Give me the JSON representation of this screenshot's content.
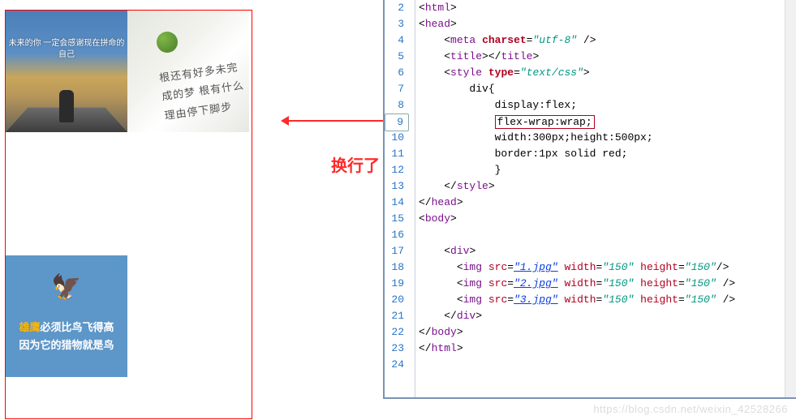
{
  "annotation": {
    "label": "换行了"
  },
  "preview": {
    "img1_text": "未来的你\n一定会感谢现在拼命的自己",
    "img2_text": "根还有好多未完成的梦\n根有什么理由停下脚步",
    "img3_text_before": "",
    "img3_text_orange": "雄鹰",
    "img3_line1_rest": "必须比鸟飞得高",
    "img3_line2": "因为它的猎物就是鸟"
  },
  "code": {
    "lines": [
      {
        "n": 2,
        "html": "<span class='t-tag'>&lt;</span><span class='t-name'>html</span><span class='t-tag'>&gt;</span>"
      },
      {
        "n": 3,
        "html": "<span class='t-tag'>&lt;</span><span class='t-name'>head</span><span class='t-tag'>&gt;</span>"
      },
      {
        "n": 4,
        "html": "    <span class='t-tag'>&lt;</span><span class='t-name'>meta</span> <span class='t-attr'>charset</span>=<span class='t-val'>\"utf-8\"</span> <span class='t-tag'>/&gt;</span>"
      },
      {
        "n": 5,
        "html": "    <span class='t-tag'>&lt;</span><span class='t-name'>title</span><span class='t-tag'>&gt;&lt;/</span><span class='t-name'>title</span><span class='t-tag'>&gt;</span>"
      },
      {
        "n": 6,
        "html": "    <span class='t-tag'>&lt;</span><span class='t-name'>style</span> <span class='t-attr'>type</span>=<span class='t-val'>\"text/css\"</span><span class='t-tag'>&gt;</span>"
      },
      {
        "n": 7,
        "html": "        div{"
      },
      {
        "n": 8,
        "html": "            display:flex;"
      },
      {
        "n": 9,
        "html": "            <span class='hl'>flex-wrap:wrap;</span>"
      },
      {
        "n": 10,
        "html": "            width:300px;height:500px;"
      },
      {
        "n": 11,
        "html": "            border:1px solid red;"
      },
      {
        "n": 12,
        "html": "            }"
      },
      {
        "n": 13,
        "html": "    <span class='t-tag'>&lt;/</span><span class='t-name'>style</span><span class='t-tag'>&gt;</span>"
      },
      {
        "n": 14,
        "html": "<span class='t-tag'>&lt;/</span><span class='t-name'>head</span><span class='t-tag'>&gt;</span>"
      },
      {
        "n": 15,
        "html": "<span class='t-tag'>&lt;</span><span class='t-name'>body</span><span class='t-tag'>&gt;</span>"
      },
      {
        "n": 16,
        "html": ""
      },
      {
        "n": 17,
        "html": "    <span class='t-tag'>&lt;</span><span class='t-name'>div</span><span class='t-tag'>&gt;</span>"
      },
      {
        "n": 18,
        "html": "      <span class='t-tag'>&lt;</span><span class='t-name'>img</span> <span class='t-attr2'>src</span>=<span class='t-str'>\"1.jpg\"</span> <span class='t-attr2'>width</span>=<span class='t-val'>\"150\"</span> <span class='t-attr2'>height</span>=<span class='t-val'>\"150\"</span><span class='t-tag'>/&gt;</span>"
      },
      {
        "n": 19,
        "html": "      <span class='t-tag'>&lt;</span><span class='t-name'>img</span> <span class='t-attr2'>src</span>=<span class='t-str'>\"2.jpg\"</span> <span class='t-attr2'>width</span>=<span class='t-val'>\"150\"</span> <span class='t-attr2'>height</span>=<span class='t-val'>\"150\"</span> <span class='t-tag'>/&gt;</span>"
      },
      {
        "n": 20,
        "html": "      <span class='t-tag'>&lt;</span><span class='t-name'>img</span> <span class='t-attr2'>src</span>=<span class='t-str'>\"3.jpg\"</span> <span class='t-attr2'>width</span>=<span class='t-val'>\"150\"</span> <span class='t-attr2'>height</span>=<span class='t-val'>\"150\"</span> <span class='t-tag'>/&gt;</span>"
      },
      {
        "n": 21,
        "html": "    <span class='t-tag'>&lt;/</span><span class='t-name'>div</span><span class='t-tag'>&gt;</span>"
      },
      {
        "n": 22,
        "html": "<span class='t-tag'>&lt;/</span><span class='t-name'>body</span><span class='t-tag'>&gt;</span>"
      },
      {
        "n": 23,
        "html": "<span class='t-tag'>&lt;/</span><span class='t-name'>html</span><span class='t-tag'>&gt;</span>"
      },
      {
        "n": 24,
        "html": ""
      }
    ]
  },
  "watermark": "https://blog.csdn.net/weixin_42528266"
}
